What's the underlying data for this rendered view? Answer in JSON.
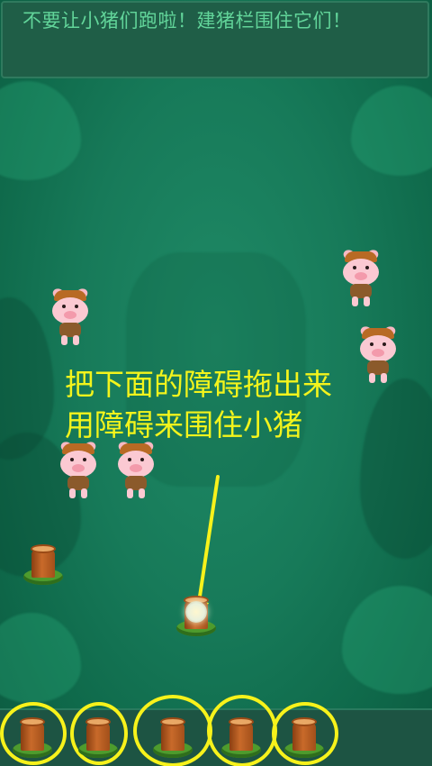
{
  "header": {
    "text": "不要让小猪们跑啦！建猪栏围住它们！"
  },
  "instructions": {
    "line1": "把下面的障碍拖出来",
    "line2": "用障碍来围住小猪"
  },
  "colors": {
    "header_text": "#62d59a",
    "instruction_text": "#f3f41c",
    "tray_highlight": "#f7f21b",
    "background": "#177a59"
  },
  "pigs": [
    {
      "id": "pig-1"
    },
    {
      "id": "pig-2"
    },
    {
      "id": "pig-3"
    },
    {
      "id": "pig-4"
    },
    {
      "id": "pig-5"
    }
  ],
  "field_obstacles": [
    {
      "id": "stump-left"
    },
    {
      "id": "stump-center"
    }
  ],
  "tray_obstacles": [
    {
      "id": "tray-stump-1",
      "highlighted": true
    },
    {
      "id": "tray-stump-2",
      "highlighted": true
    },
    {
      "id": "tray-stump-3",
      "highlighted": true
    },
    {
      "id": "tray-stump-4",
      "highlighted": true
    },
    {
      "id": "tray-stump-5",
      "highlighted": true
    }
  ],
  "icons": {
    "pig": "pig-icon",
    "stump": "tree-stump-icon",
    "arrow": "arrow-down-icon"
  }
}
